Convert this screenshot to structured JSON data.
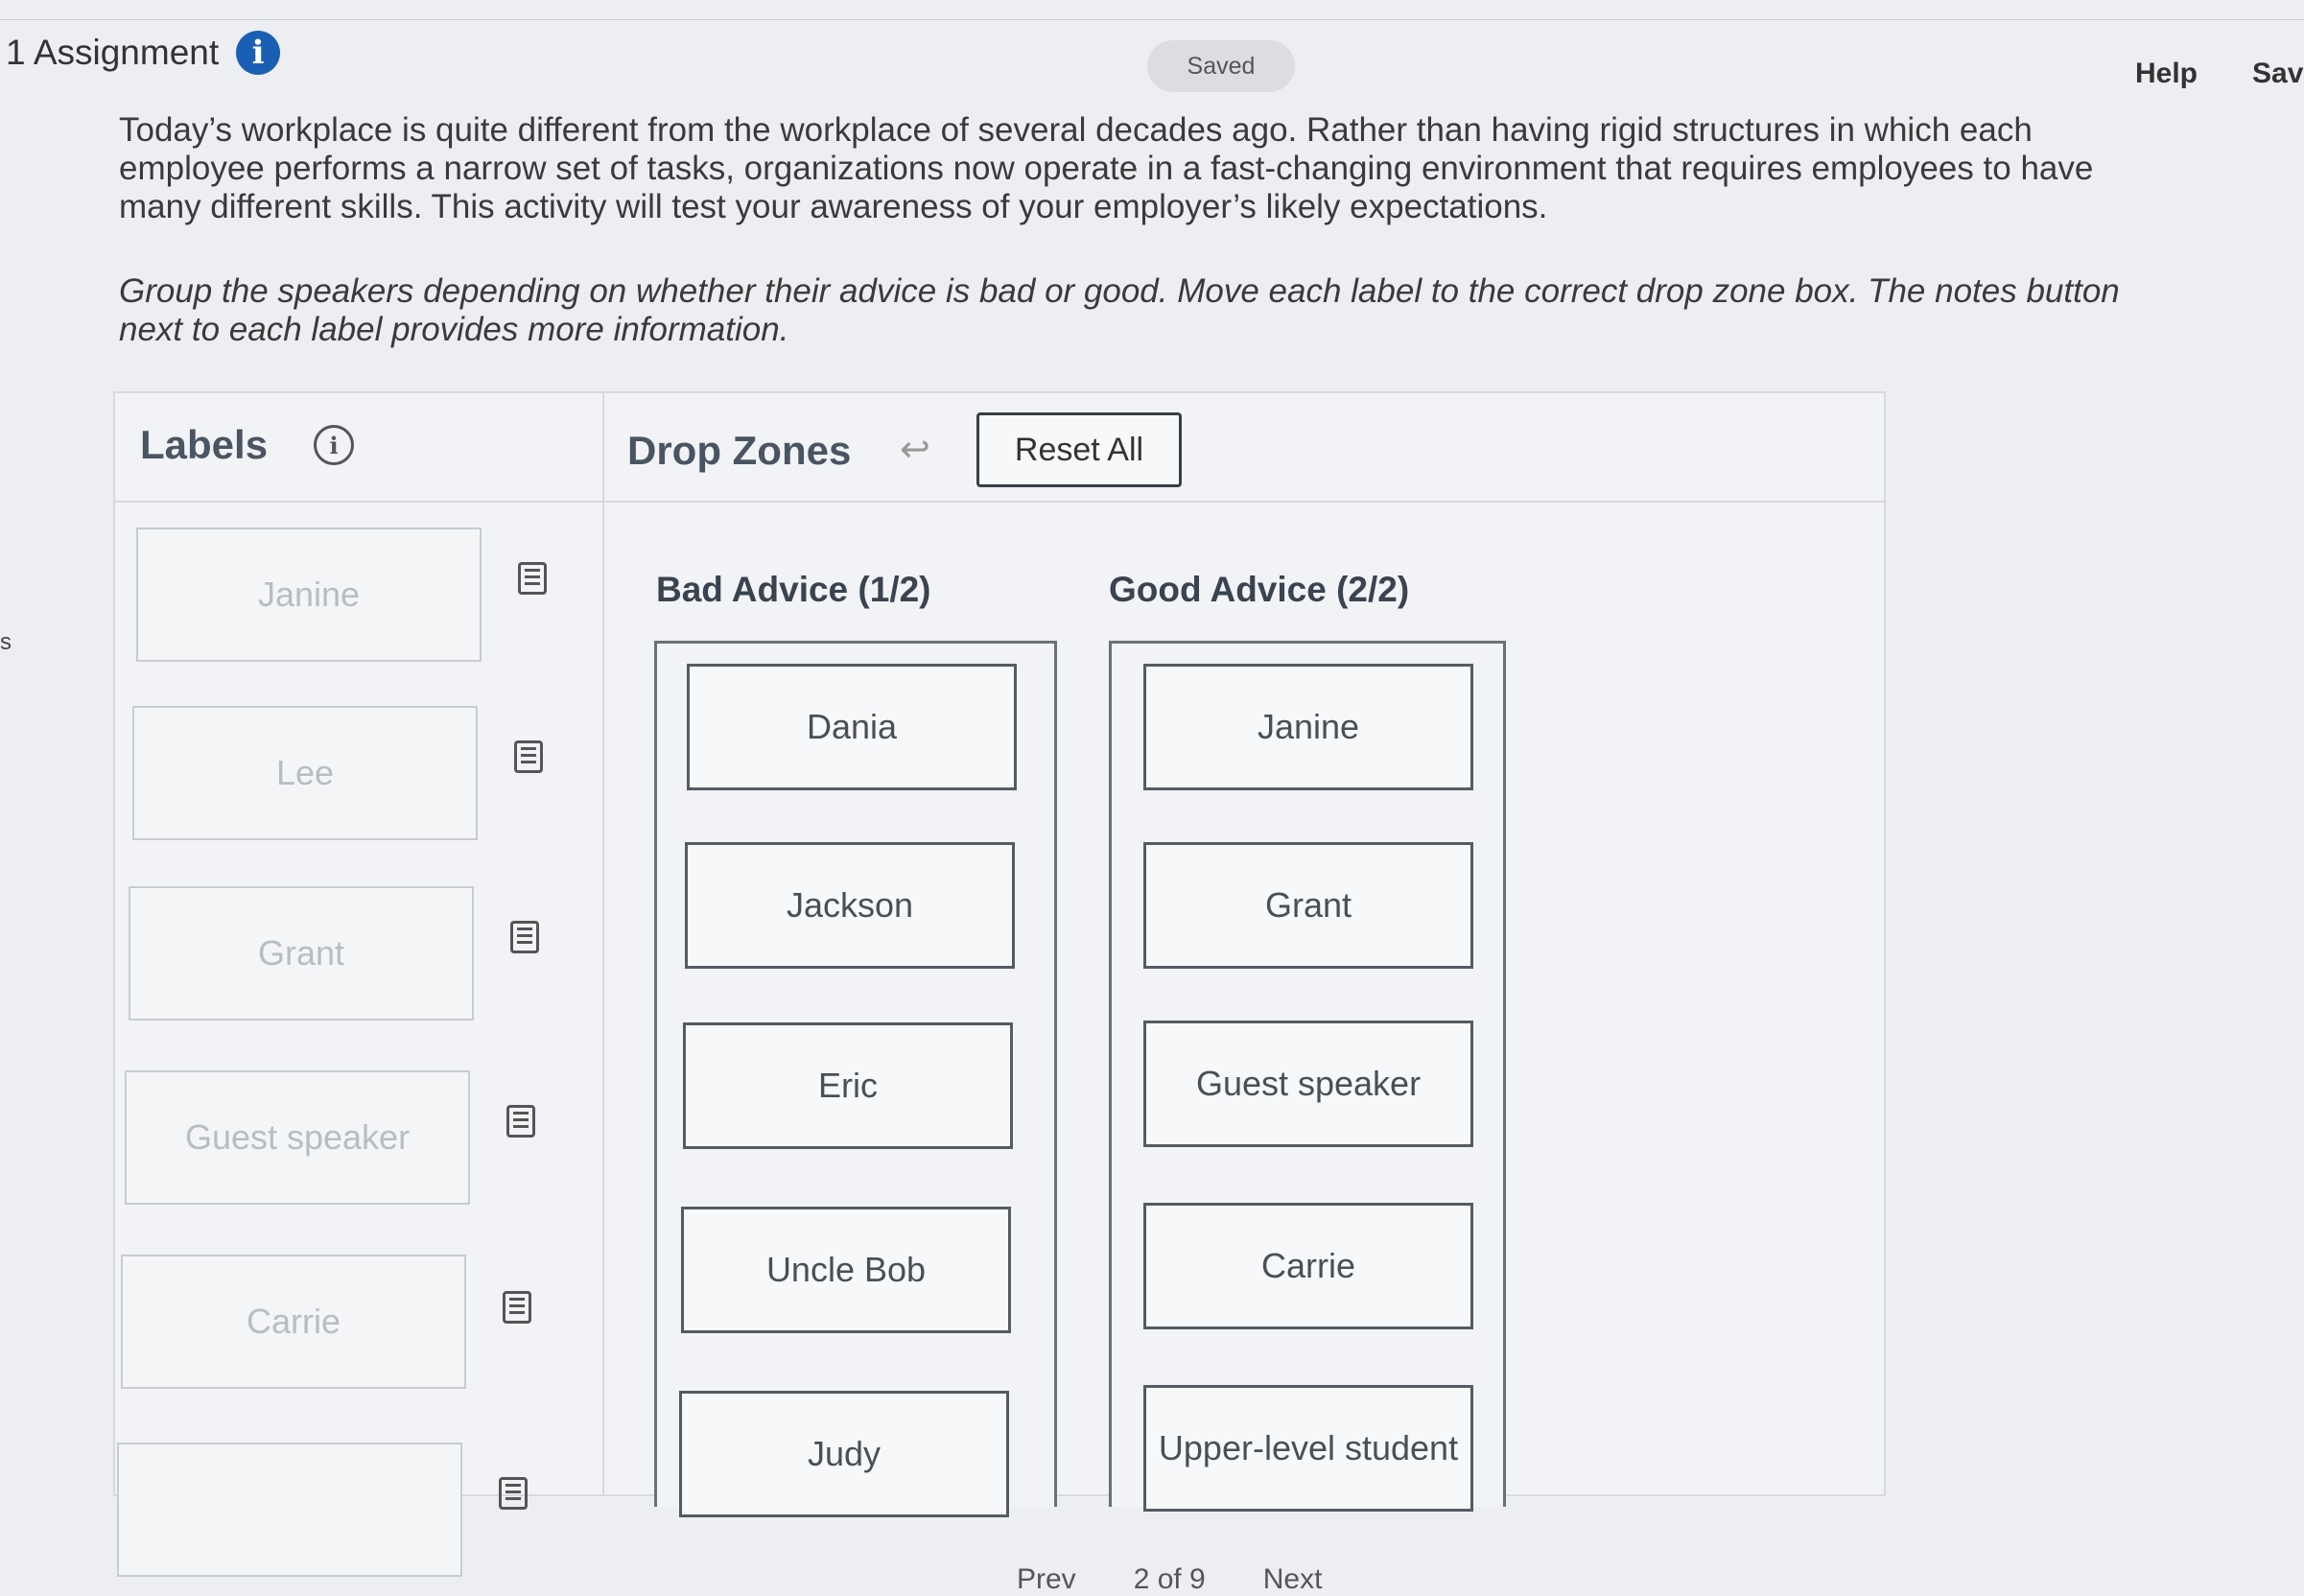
{
  "header": {
    "assignment_label": "1 Assignment",
    "info_icon": "info-circle-icon",
    "saved_status": "Saved",
    "help_label": "Help",
    "save_label": "Sav",
    "edge_text": "s"
  },
  "content": {
    "intro": "Today’s workplace is quite different from the workplace of several decades ago. Rather than having rigid structures in which each employee performs a narrow set of tasks, organizations now operate in a fast-changing environment that requires employees to have many different skills. This activity will test your awareness of your employer’s likely expectations.",
    "instructions": "Group the speakers depending on whether their advice is bad or good. Move each label to the correct drop zone box. The notes button next to each label provides more information."
  },
  "labels_panel": {
    "title": "Labels",
    "items": [
      {
        "label": "Janine"
      },
      {
        "label": "Lee"
      },
      {
        "label": "Grant"
      },
      {
        "label": "Guest speaker"
      },
      {
        "label": "Carrie"
      },
      {
        "label": ""
      }
    ]
  },
  "drop_zones": {
    "title": "Drop Zones",
    "undo_icon": "undo-arrow-icon",
    "reset_label": "Reset All",
    "bad": {
      "title": "Bad Advice (1/2)",
      "items": [
        "Dania",
        "Jackson",
        "Eric",
        "Uncle Bob",
        "Judy"
      ]
    },
    "good": {
      "title": "Good Advice (2/2)",
      "items": [
        "Janine",
        "Grant",
        "Guest speaker",
        "Carrie",
        "Upper-level student"
      ]
    }
  },
  "footer": {
    "prev_label": "Prev",
    "page": "2 of 9",
    "next_label": "Next"
  }
}
